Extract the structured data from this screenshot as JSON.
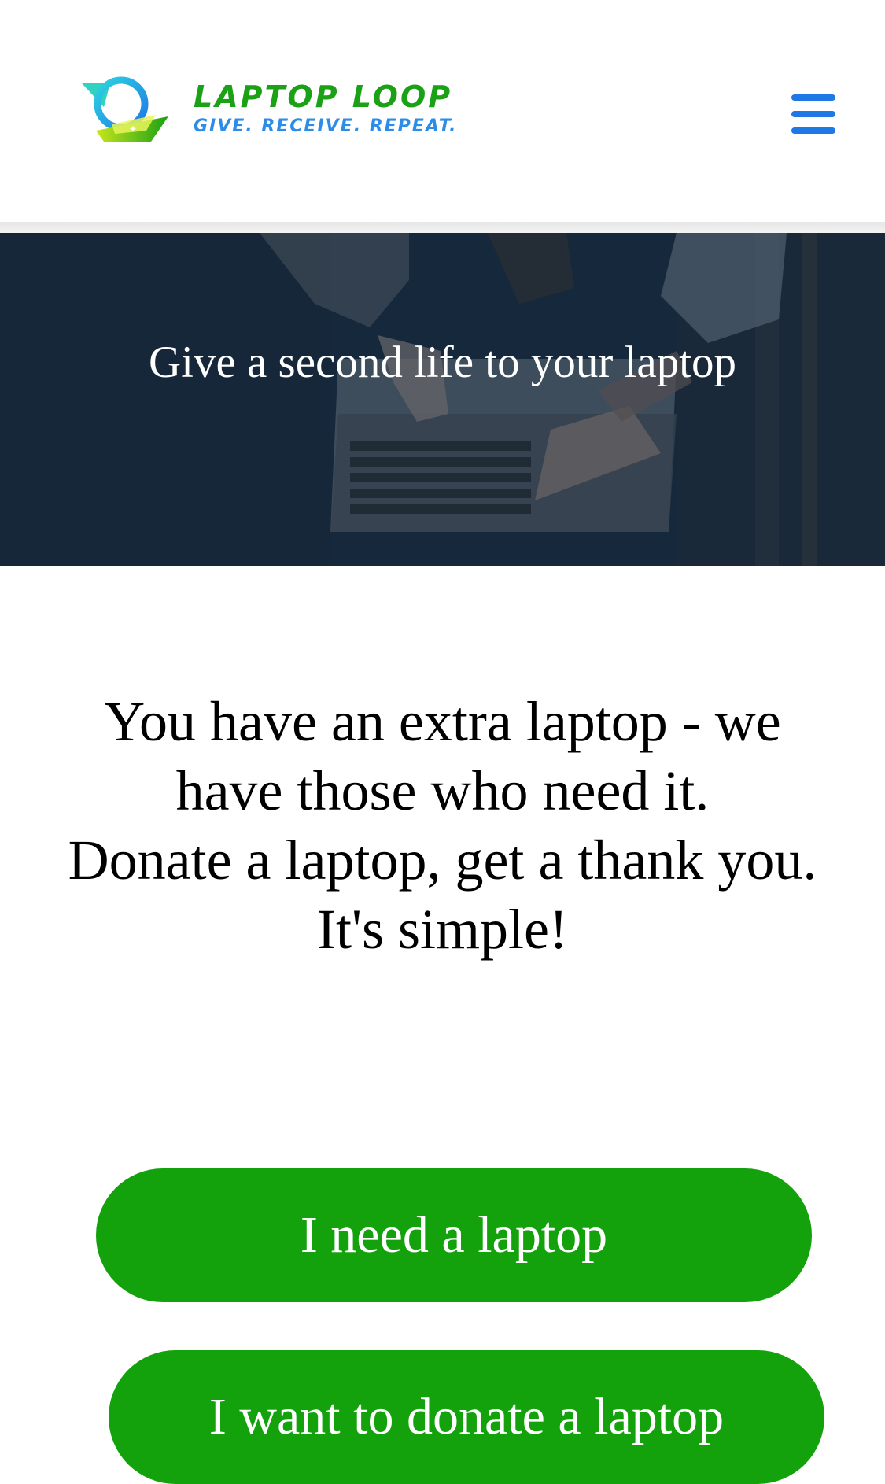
{
  "header": {
    "brand_name": "LAPTOP LOOP",
    "brand_tagline": "GIVE. RECEIVE. REPEAT.",
    "menu_icon": "hamburger-menu-icon",
    "brand_green": "#1aa116",
    "brand_blue": "#2d8ce8"
  },
  "hero": {
    "title": "Give a second life to your laptop",
    "image": "people-pointing-at-laptop-photo"
  },
  "intro": {
    "line1": "You have an extra laptop - we have those who need it.",
    "line2": "Donate a laptop, get a thank you.",
    "line3": "It's simple!"
  },
  "actions": {
    "need_label": "I need a laptop",
    "donate_label": "I want to donate a laptop",
    "button_color": "#13a10c"
  }
}
